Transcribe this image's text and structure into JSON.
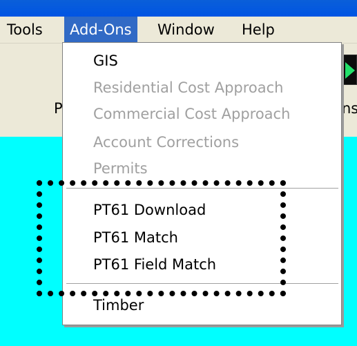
{
  "menubar": {
    "items": [
      {
        "label": "Tools"
      },
      {
        "label": "Add-Ons"
      },
      {
        "label": "Window"
      },
      {
        "label": "Help"
      }
    ]
  },
  "toolbar": {
    "left_fragment": "P",
    "right_fragment": "ns"
  },
  "addons_menu": {
    "items": [
      {
        "label": "GIS",
        "enabled": true
      },
      {
        "label": "Residential Cost Approach",
        "enabled": false
      },
      {
        "label": "Commercial Cost Approach",
        "enabled": false
      },
      {
        "label": "Account Corrections",
        "enabled": false
      },
      {
        "label": "Permits",
        "enabled": false
      },
      {
        "label": "PT61 Download",
        "enabled": true
      },
      {
        "label": "PT61 Match",
        "enabled": true
      },
      {
        "label": "PT61 Field Match",
        "enabled": true
      },
      {
        "label": "Timber",
        "enabled": true
      }
    ]
  },
  "colors": {
    "menu_highlight": "#316ac5",
    "background_cyan": "#00ffff",
    "menubar": "#ece9d8",
    "disabled_text": "#a0a0a0"
  }
}
